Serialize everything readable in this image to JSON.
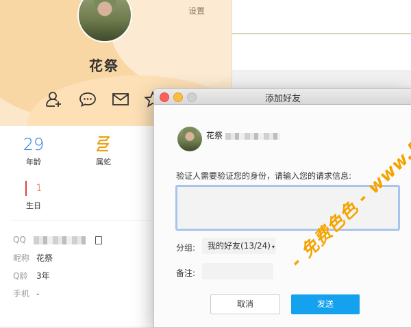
{
  "profile": {
    "settings_label": "设置",
    "nickname": "花祭",
    "actions": [
      {
        "icon": "add-friend-icon"
      },
      {
        "icon": "chat-bubble-icon"
      },
      {
        "icon": "mail-icon"
      },
      {
        "icon": "star-icon"
      }
    ],
    "age": {
      "value": "29",
      "label": "年龄"
    },
    "zodiac": {
      "label": "属蛇",
      "icon": "snake-zodiac-icon"
    },
    "birthday": {
      "value": "1",
      "label": "生日"
    },
    "info": {
      "qq_label": "QQ",
      "nick_label": "昵称",
      "nick_value": "花祭",
      "age_label": "Q龄",
      "age_value": "3年",
      "phone_label": "手机",
      "phone_value": "-"
    }
  },
  "dialog": {
    "title": "添加好友",
    "friend_name": "花祭",
    "prompt": "验证人需要验证您的身份，请输入您的请求信息:",
    "message_value": "",
    "group_label": "分组:",
    "group_value": "我的好友(13/24)",
    "remark_label": "备注:",
    "remark_value": "",
    "cancel_label": "取消",
    "send_label": "发送"
  },
  "watermark": {
    "text": "- 免费色色 - www.MFsese.com",
    "color": "#f5a300"
  },
  "colors": {
    "accent": "#14a1ee",
    "age_number": "#2b7ddd",
    "zodiac": "#e8a317",
    "birthday": "#e0403a",
    "close_light": "#fc605c",
    "minimize_light": "#fdbc40"
  }
}
